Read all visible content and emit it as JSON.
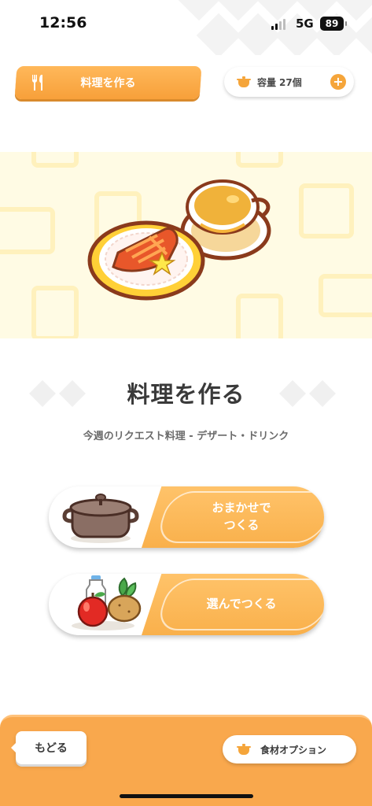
{
  "status_bar": {
    "time": "12:56",
    "network": "5G",
    "battery": "89"
  },
  "header": {
    "tab_label": "料理を作る",
    "capacity_label": "容量",
    "capacity_value": "27個",
    "plus_symbol": "+"
  },
  "main": {
    "title": "料理を作る",
    "subtitle": "今週のリクエスト料理 - デザート・ドリンク",
    "buttons": [
      {
        "label": "おまかせで\nつくる",
        "icon": "cooking-pot"
      },
      {
        "label": "選んでつくる",
        "icon": "ingredients"
      }
    ]
  },
  "footer": {
    "back_label": "もどる",
    "option_label": "食材オプション"
  },
  "colors": {
    "accent": "#f9a84d",
    "button_orange": "#f9b04b",
    "hero_bg": "#fffbe4"
  }
}
